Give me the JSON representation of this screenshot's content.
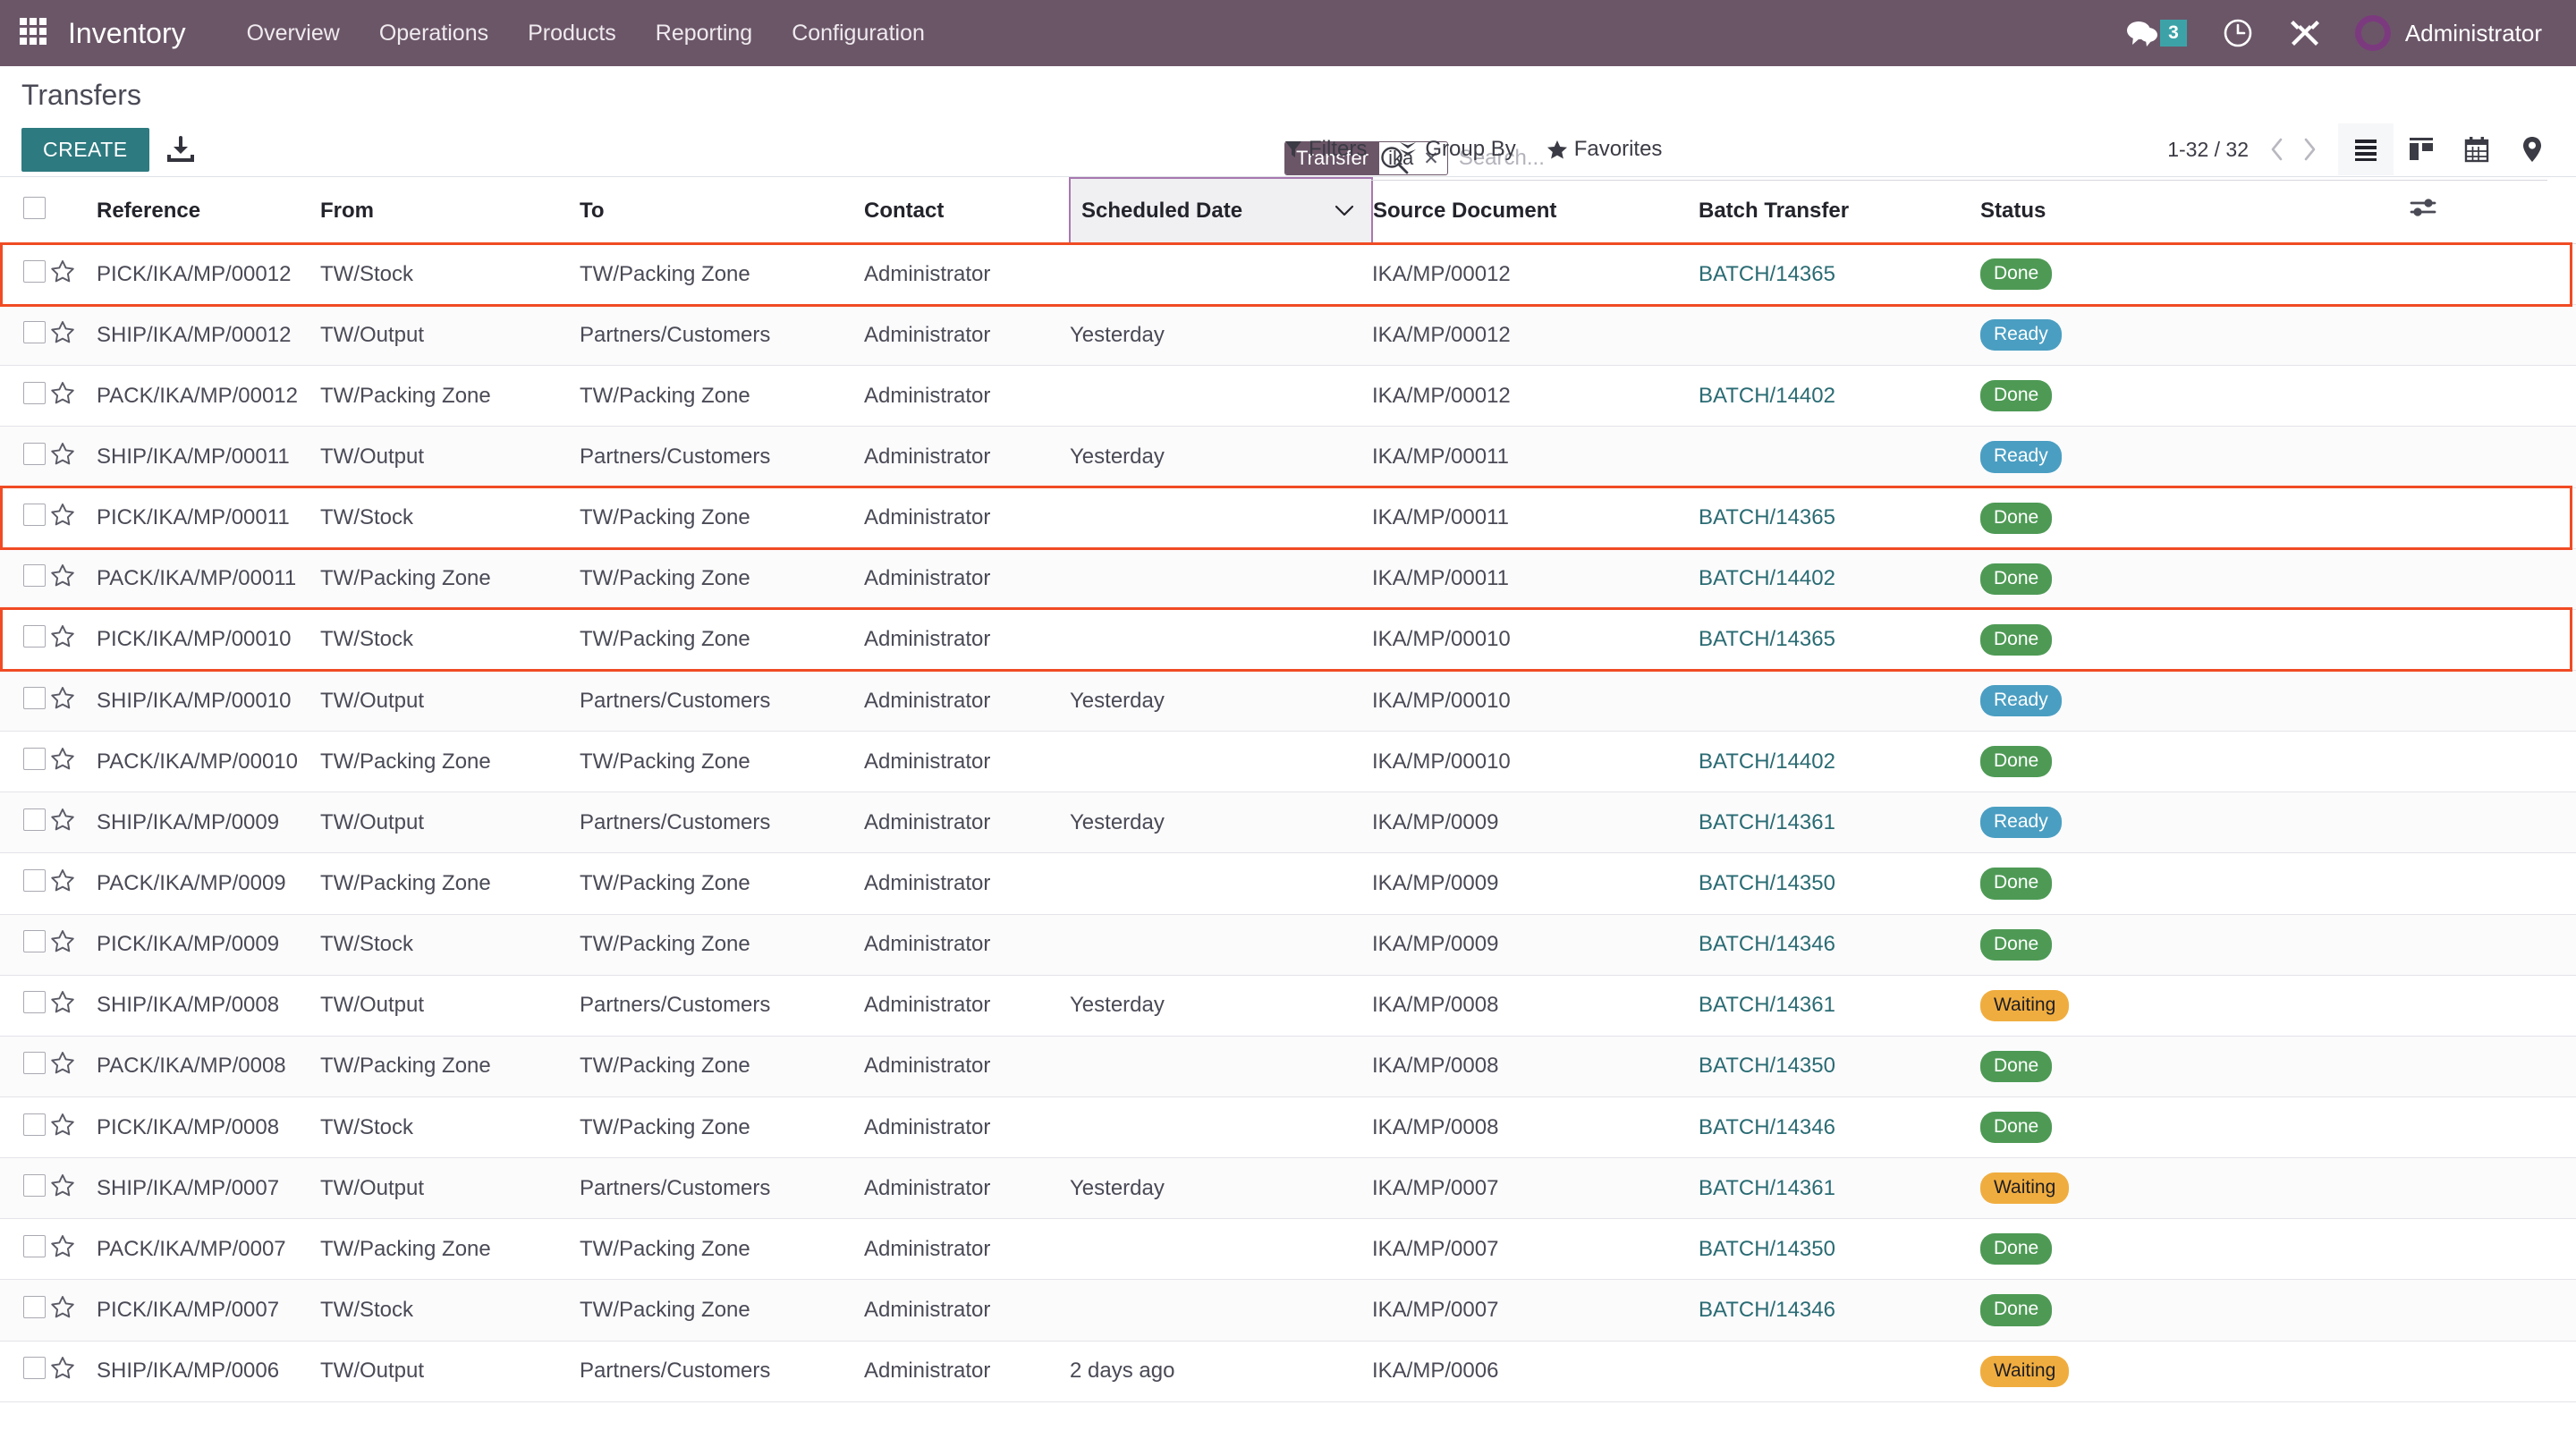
{
  "navbar": {
    "apps_icon": "apps-grid-icon",
    "brand": "Inventory",
    "menus": [
      "Overview",
      "Operations",
      "Products",
      "Reporting",
      "Configuration"
    ],
    "messages_icon": "chat-bubble-icon",
    "messages_count": "3",
    "activities_icon": "clock-icon",
    "debug_icon": "tools-icon",
    "avatar_icon": "user-avatar",
    "user_name": "Administrator",
    "bg_color": "#6b5668",
    "badge_color": "#3ca2a8"
  },
  "control_panel": {
    "title": "Transfers",
    "create_label": "CREATE",
    "create_color": "#2d7a80",
    "import_icon": "import-download-icon",
    "search": {
      "facet_label": "Transfer",
      "facet_value": "ika",
      "facet_remove_icon": "close-x-icon",
      "placeholder": "Search...",
      "value": "",
      "search_icon": "search-magnifier-icon"
    },
    "filters": [
      {
        "label": "Filters",
        "icon": "filter-funnel-icon"
      },
      {
        "label": "Group By",
        "icon": "group-by-chevrons-icon"
      },
      {
        "label": "Favorites",
        "icon": "star-filled-icon"
      }
    ],
    "pager": "1-32 / 32",
    "pager_prev_icon": "chevron-left-icon",
    "pager_next_icon": "chevron-right-icon",
    "views": [
      {
        "name": "list-view",
        "icon": "list-view-icon",
        "active": true
      },
      {
        "name": "kanban-view",
        "icon": "kanban-view-icon",
        "active": false
      },
      {
        "name": "calendar-view",
        "icon": "calendar-view-icon",
        "active": false
      },
      {
        "name": "map-view",
        "icon": "map-pin-icon",
        "active": false
      }
    ]
  },
  "table": {
    "columns": [
      "Reference",
      "From",
      "To",
      "Contact",
      "Scheduled Date",
      "Source Document",
      "Batch Transfer",
      "Status"
    ],
    "sorted_column": "Scheduled Date",
    "sort_icon": "chevron-down-icon",
    "options_icon": "column-options-sliders-icon",
    "select_all_icon": "checkbox-unchecked",
    "row_star_icon": "star-outline-icon",
    "rows": [
      {
        "reference": "PICK/IKA/MP/00012",
        "from": "TW/Stock",
        "to": "TW/Packing Zone",
        "contact": "Administrator",
        "scheduled": "",
        "source": "IKA/MP/00012",
        "batch": "BATCH/14365",
        "status": "Done",
        "highlighted": true
      },
      {
        "reference": "SHIP/IKA/MP/00012",
        "from": "TW/Output",
        "to": "Partners/Customers",
        "contact": "Administrator",
        "scheduled": "Yesterday",
        "source": "IKA/MP/00012",
        "batch": "",
        "status": "Ready",
        "highlighted": false
      },
      {
        "reference": "PACK/IKA/MP/00012",
        "from": "TW/Packing Zone",
        "to": "TW/Packing Zone",
        "contact": "Administrator",
        "scheduled": "",
        "source": "IKA/MP/00012",
        "batch": "BATCH/14402",
        "status": "Done",
        "highlighted": false
      },
      {
        "reference": "SHIP/IKA/MP/00011",
        "from": "TW/Output",
        "to": "Partners/Customers",
        "contact": "Administrator",
        "scheduled": "Yesterday",
        "source": "IKA/MP/00011",
        "batch": "",
        "status": "Ready",
        "highlighted": false
      },
      {
        "reference": "PICK/IKA/MP/00011",
        "from": "TW/Stock",
        "to": "TW/Packing Zone",
        "contact": "Administrator",
        "scheduled": "",
        "source": "IKA/MP/00011",
        "batch": "BATCH/14365",
        "status": "Done",
        "highlighted": true
      },
      {
        "reference": "PACK/IKA/MP/00011",
        "from": "TW/Packing Zone",
        "to": "TW/Packing Zone",
        "contact": "Administrator",
        "scheduled": "",
        "source": "IKA/MP/00011",
        "batch": "BATCH/14402",
        "status": "Done",
        "highlighted": false
      },
      {
        "reference": "PICK/IKA/MP/00010",
        "from": "TW/Stock",
        "to": "TW/Packing Zone",
        "contact": "Administrator",
        "scheduled": "",
        "source": "IKA/MP/00010",
        "batch": "BATCH/14365",
        "status": "Done",
        "highlighted": true
      },
      {
        "reference": "SHIP/IKA/MP/00010",
        "from": "TW/Output",
        "to": "Partners/Customers",
        "contact": "Administrator",
        "scheduled": "Yesterday",
        "source": "IKA/MP/00010",
        "batch": "",
        "status": "Ready",
        "highlighted": false
      },
      {
        "reference": "PACK/IKA/MP/00010",
        "from": "TW/Packing Zone",
        "to": "TW/Packing Zone",
        "contact": "Administrator",
        "scheduled": "",
        "source": "IKA/MP/00010",
        "batch": "BATCH/14402",
        "status": "Done",
        "highlighted": false
      },
      {
        "reference": "SHIP/IKA/MP/0009",
        "from": "TW/Output",
        "to": "Partners/Customers",
        "contact": "Administrator",
        "scheduled": "Yesterday",
        "source": "IKA/MP/0009",
        "batch": "BATCH/14361",
        "status": "Ready",
        "highlighted": false
      },
      {
        "reference": "PACK/IKA/MP/0009",
        "from": "TW/Packing Zone",
        "to": "TW/Packing Zone",
        "contact": "Administrator",
        "scheduled": "",
        "source": "IKA/MP/0009",
        "batch": "BATCH/14350",
        "status": "Done",
        "highlighted": false
      },
      {
        "reference": "PICK/IKA/MP/0009",
        "from": "TW/Stock",
        "to": "TW/Packing Zone",
        "contact": "Administrator",
        "scheduled": "",
        "source": "IKA/MP/0009",
        "batch": "BATCH/14346",
        "status": "Done",
        "highlighted": false
      },
      {
        "reference": "SHIP/IKA/MP/0008",
        "from": "TW/Output",
        "to": "Partners/Customers",
        "contact": "Administrator",
        "scheduled": "Yesterday",
        "source": "IKA/MP/0008",
        "batch": "BATCH/14361",
        "status": "Waiting",
        "highlighted": false
      },
      {
        "reference": "PACK/IKA/MP/0008",
        "from": "TW/Packing Zone",
        "to": "TW/Packing Zone",
        "contact": "Administrator",
        "scheduled": "",
        "source": "IKA/MP/0008",
        "batch": "BATCH/14350",
        "status": "Done",
        "highlighted": false
      },
      {
        "reference": "PICK/IKA/MP/0008",
        "from": "TW/Stock",
        "to": "TW/Packing Zone",
        "contact": "Administrator",
        "scheduled": "",
        "source": "IKA/MP/0008",
        "batch": "BATCH/14346",
        "status": "Done",
        "highlighted": false
      },
      {
        "reference": "SHIP/IKA/MP/0007",
        "from": "TW/Output",
        "to": "Partners/Customers",
        "contact": "Administrator",
        "scheduled": "Yesterday",
        "source": "IKA/MP/0007",
        "batch": "BATCH/14361",
        "status": "Waiting",
        "highlighted": false
      },
      {
        "reference": "PACK/IKA/MP/0007",
        "from": "TW/Packing Zone",
        "to": "TW/Packing Zone",
        "contact": "Administrator",
        "scheduled": "",
        "source": "IKA/MP/0007",
        "batch": "BATCH/14350",
        "status": "Done",
        "highlighted": false
      },
      {
        "reference": "PICK/IKA/MP/0007",
        "from": "TW/Stock",
        "to": "TW/Packing Zone",
        "contact": "Administrator",
        "scheduled": "",
        "source": "IKA/MP/0007",
        "batch": "BATCH/14346",
        "status": "Done",
        "highlighted": false
      },
      {
        "reference": "SHIP/IKA/MP/0006",
        "from": "TW/Output",
        "to": "Partners/Customers",
        "contact": "Administrator",
        "scheduled": "2 days ago",
        "source": "IKA/MP/0006",
        "batch": "",
        "status": "Waiting",
        "highlighted": false
      }
    ],
    "status_colors": {
      "Done": "#4e9a55",
      "Ready": "#4a9ec2",
      "Waiting": "#f0ad3f"
    },
    "overdue_color": "#c8442e",
    "link_color": "#2a6b73",
    "highlight_color": "#f04b24"
  }
}
